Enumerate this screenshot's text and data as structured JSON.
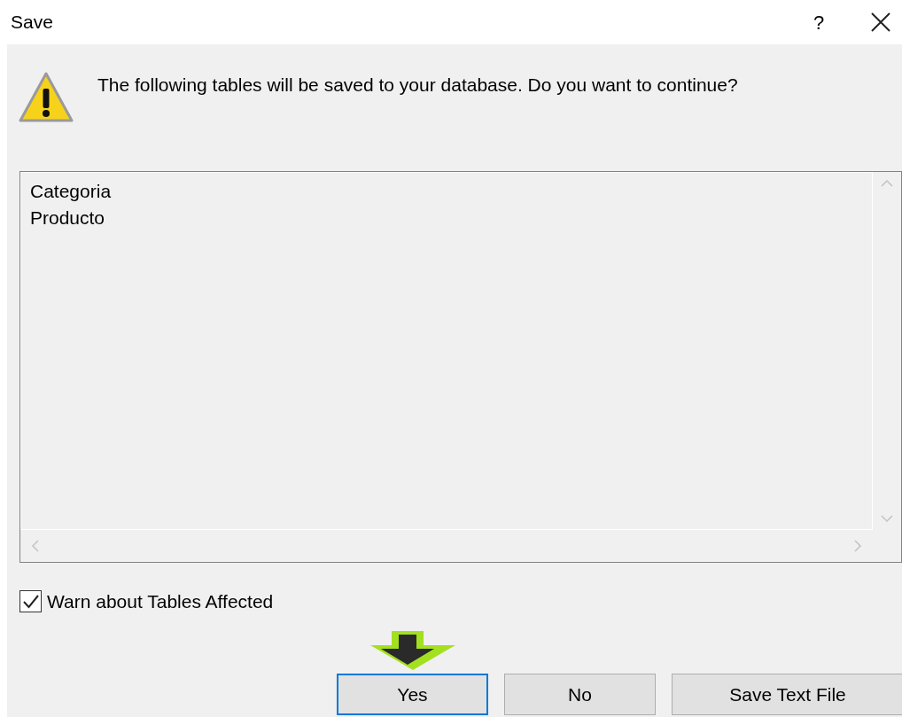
{
  "window": {
    "title": "Save",
    "help": "?"
  },
  "message": "The following tables will be saved to your database. Do you want to continue?",
  "tables": [
    "Categoria",
    "Producto"
  ],
  "warn_checkbox": {
    "label": "Warn about Tables Affected",
    "checked": true
  },
  "buttons": [
    {
      "label": "Yes",
      "focused": true
    },
    {
      "label": "No",
      "focused": false
    },
    {
      "label": "Save Text File",
      "focused": false
    }
  ]
}
